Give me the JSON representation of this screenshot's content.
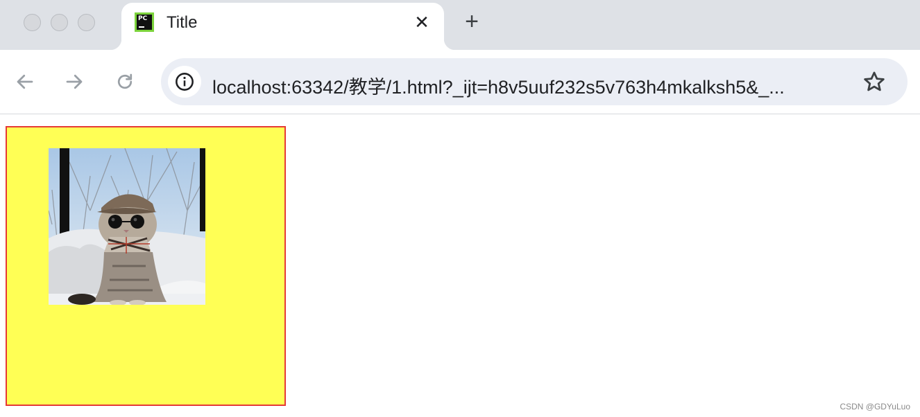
{
  "browser": {
    "tab": {
      "title": "Title",
      "favicon_text": "PC",
      "close_glyph": "✕"
    },
    "new_tab_glyph": "+",
    "address_bar": {
      "url": "localhost:63342/教学/1.html?_ijt=h8v5uuf232s5v763h4mkalksh5&_..."
    },
    "icons": [
      "back-arrow-icon",
      "forward-arrow-icon",
      "reload-icon",
      "info-icon",
      "star-icon"
    ]
  },
  "page": {
    "box_colors": {
      "background": "#ffff55",
      "border": "#e53935"
    },
    "image": "photo of a cat wearing a flat cap, round sunglasses and plaid scarf"
  },
  "watermark": "CSDN @GDYuLuo"
}
